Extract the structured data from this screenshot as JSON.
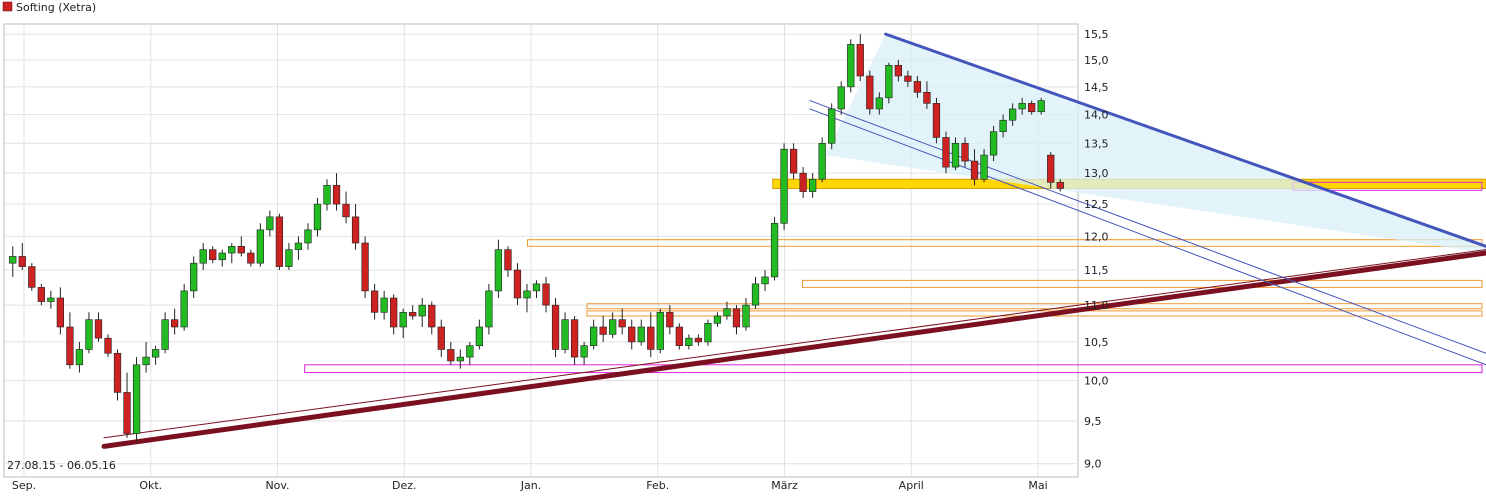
{
  "chart_data": {
    "type": "candlestick",
    "title": "Softing (Xetra)",
    "date_range_label": "27.08.15 - 06.05.16",
    "x_labels": [
      "Sep.",
      "Okt.",
      "Nov.",
      "Dez.",
      "Jan.",
      "Feb.",
      "März",
      "April",
      "Mai"
    ],
    "y_ticks": [
      "9,0",
      "9,5",
      "10,0",
      "10,5",
      "11,0",
      "11,5",
      "12,0",
      "12,5",
      "13,0",
      "13,5",
      "14,0",
      "14,5",
      "15,0",
      "15,5"
    ],
    "ylim": [
      8.85,
      15.7
    ],
    "scale": "log",
    "grid": true,
    "colors": {
      "up": "#22bb22",
      "down": "#cc2222",
      "support_main": "#7a1020",
      "channel": "#4455bb",
      "zone": "#ffd700",
      "band_orange": "#ee9933",
      "band_magenta": "#dd22dd",
      "fill_channel": "#d8f0f8"
    },
    "candles": [
      [
        11.6,
        11.85,
        11.4,
        11.7
      ],
      [
        11.7,
        11.9,
        11.5,
        11.55
      ],
      [
        11.55,
        11.6,
        11.2,
        11.25
      ],
      [
        11.25,
        11.3,
        11.0,
        11.05
      ],
      [
        11.05,
        11.2,
        10.95,
        11.1
      ],
      [
        11.1,
        11.25,
        10.6,
        10.7
      ],
      [
        10.7,
        10.9,
        10.15,
        10.2
      ],
      [
        10.2,
        10.5,
        10.1,
        10.4
      ],
      [
        10.4,
        10.9,
        10.35,
        10.8
      ],
      [
        10.8,
        10.9,
        10.5,
        10.55
      ],
      [
        10.55,
        10.6,
        10.3,
        10.35
      ],
      [
        10.35,
        10.4,
        9.75,
        9.85
      ],
      [
        9.85,
        10.1,
        9.3,
        9.35
      ],
      [
        9.35,
        10.3,
        9.25,
        10.2
      ],
      [
        10.2,
        10.5,
        10.1,
        10.3
      ],
      [
        10.3,
        10.45,
        10.2,
        10.4
      ],
      [
        10.4,
        10.9,
        10.35,
        10.8
      ],
      [
        10.8,
        10.95,
        10.6,
        10.7
      ],
      [
        10.7,
        11.3,
        10.65,
        11.2
      ],
      [
        11.2,
        11.7,
        11.1,
        11.6
      ],
      [
        11.6,
        11.9,
        11.5,
        11.8
      ],
      [
        11.8,
        11.85,
        11.6,
        11.65
      ],
      [
        11.65,
        11.8,
        11.55,
        11.75
      ],
      [
        11.75,
        11.9,
        11.6,
        11.85
      ],
      [
        11.85,
        12.0,
        11.7,
        11.75
      ],
      [
        11.75,
        11.8,
        11.55,
        11.6
      ],
      [
        11.6,
        12.2,
        11.55,
        12.1
      ],
      [
        12.1,
        12.4,
        12.0,
        12.3
      ],
      [
        12.3,
        12.35,
        11.5,
        11.55
      ],
      [
        11.55,
        11.9,
        11.5,
        11.8
      ],
      [
        11.8,
        12.0,
        11.65,
        11.9
      ],
      [
        11.9,
        12.2,
        11.8,
        12.1
      ],
      [
        12.1,
        12.6,
        12.0,
        12.5
      ],
      [
        12.5,
        12.9,
        12.4,
        12.8
      ],
      [
        12.8,
        13.0,
        12.4,
        12.5
      ],
      [
        12.5,
        12.7,
        12.2,
        12.3
      ],
      [
        12.3,
        12.5,
        11.8,
        11.9
      ],
      [
        11.9,
        12.0,
        11.1,
        11.2
      ],
      [
        11.2,
        11.3,
        10.8,
        10.9
      ],
      [
        10.9,
        11.2,
        10.8,
        11.1
      ],
      [
        11.1,
        11.15,
        10.6,
        10.7
      ],
      [
        10.7,
        10.95,
        10.55,
        10.9
      ],
      [
        10.9,
        11.0,
        10.8,
        10.85
      ],
      [
        10.85,
        11.1,
        10.7,
        11.0
      ],
      [
        11.0,
        11.05,
        10.6,
        10.7
      ],
      [
        10.7,
        10.8,
        10.3,
        10.4
      ],
      [
        10.4,
        10.5,
        10.2,
        10.25
      ],
      [
        10.25,
        10.4,
        10.15,
        10.3
      ],
      [
        10.3,
        10.5,
        10.2,
        10.45
      ],
      [
        10.45,
        10.8,
        10.4,
        10.7
      ],
      [
        10.7,
        11.3,
        10.6,
        11.2
      ],
      [
        11.2,
        11.95,
        11.1,
        11.8
      ],
      [
        11.8,
        11.85,
        11.4,
        11.5
      ],
      [
        11.5,
        11.6,
        11.0,
        11.1
      ],
      [
        11.1,
        11.3,
        10.9,
        11.2
      ],
      [
        11.2,
        11.35,
        11.1,
        11.3
      ],
      [
        11.3,
        11.4,
        10.9,
        11.0
      ],
      [
        11.0,
        11.1,
        10.3,
        10.4
      ],
      [
        10.4,
        10.9,
        10.35,
        10.8
      ],
      [
        10.8,
        10.85,
        10.2,
        10.3
      ],
      [
        10.3,
        10.5,
        10.2,
        10.45
      ],
      [
        10.45,
        10.8,
        10.4,
        10.7
      ],
      [
        10.7,
        10.85,
        10.5,
        10.6
      ],
      [
        10.6,
        10.9,
        10.55,
        10.8
      ],
      [
        10.8,
        10.95,
        10.6,
        10.7
      ],
      [
        10.7,
        10.8,
        10.4,
        10.5
      ],
      [
        10.5,
        10.8,
        10.45,
        10.7
      ],
      [
        10.7,
        10.9,
        10.3,
        10.4
      ],
      [
        10.4,
        10.95,
        10.35,
        10.9
      ],
      [
        10.9,
        11.0,
        10.6,
        10.7
      ],
      [
        10.7,
        10.75,
        10.4,
        10.45
      ],
      [
        10.45,
        10.6,
        10.4,
        10.55
      ],
      [
        10.55,
        10.6,
        10.45,
        10.5
      ],
      [
        10.5,
        10.8,
        10.45,
        10.75
      ],
      [
        10.75,
        10.9,
        10.7,
        10.85
      ],
      [
        10.85,
        11.05,
        10.8,
        10.95
      ],
      [
        10.95,
        11.0,
        10.6,
        10.7
      ],
      [
        10.7,
        11.1,
        10.65,
        11.0
      ],
      [
        11.0,
        11.4,
        10.95,
        11.3
      ],
      [
        11.3,
        11.5,
        11.2,
        11.4
      ],
      [
        11.4,
        12.3,
        11.35,
        12.2
      ],
      [
        12.2,
        13.5,
        12.1,
        13.4
      ],
      [
        13.4,
        13.5,
        12.9,
        13.0
      ],
      [
        13.0,
        13.1,
        12.6,
        12.7
      ],
      [
        12.7,
        13.0,
        12.6,
        12.9
      ],
      [
        12.9,
        13.6,
        12.85,
        13.5
      ],
      [
        13.5,
        14.2,
        13.4,
        14.1
      ],
      [
        14.1,
        14.6,
        14.0,
        14.5
      ],
      [
        14.5,
        15.4,
        14.4,
        15.3
      ],
      [
        15.3,
        15.5,
        14.6,
        14.7
      ],
      [
        14.7,
        14.8,
        14.0,
        14.1
      ],
      [
        14.1,
        14.4,
        14.0,
        14.3
      ],
      [
        14.3,
        14.95,
        14.2,
        14.9
      ],
      [
        14.9,
        15.0,
        14.6,
        14.7
      ],
      [
        14.7,
        14.8,
        14.5,
        14.6
      ],
      [
        14.6,
        14.7,
        14.3,
        14.4
      ],
      [
        14.4,
        14.6,
        14.1,
        14.2
      ],
      [
        14.2,
        14.3,
        13.5,
        13.6
      ],
      [
        13.6,
        13.7,
        13.0,
        13.1
      ],
      [
        13.1,
        13.6,
        13.05,
        13.5
      ],
      [
        13.5,
        13.6,
        13.1,
        13.2
      ],
      [
        13.2,
        13.4,
        12.8,
        12.9
      ],
      [
        12.9,
        13.4,
        12.85,
        13.3
      ],
      [
        13.3,
        13.8,
        13.2,
        13.7
      ],
      [
        13.7,
        14.0,
        13.6,
        13.9
      ],
      [
        13.9,
        14.2,
        13.8,
        14.1
      ],
      [
        14.1,
        14.3,
        14.0,
        14.2
      ],
      [
        14.2,
        14.25,
        14.0,
        14.05
      ],
      [
        14.05,
        14.3,
        14.0,
        14.25
      ],
      [
        13.3,
        13.35,
        12.75,
        12.85
      ],
      [
        12.85,
        12.9,
        12.7,
        12.75
      ]
    ],
    "lines": [
      {
        "kind": "main_support",
        "points": [
          [
            0.07,
            9.2
          ],
          [
            1.0,
            11.75
          ]
        ]
      },
      {
        "kind": "support_thin",
        "points": [
          [
            0.07,
            9.3
          ],
          [
            1.0,
            11.8
          ]
        ]
      },
      {
        "kind": "channel_upper",
        "points": [
          [
            0.596,
            15.5
          ],
          [
            1.0,
            11.85
          ]
        ]
      },
      {
        "kind": "channel_lower",
        "points": [
          [
            0.545,
            14.1
          ],
          [
            1.0,
            10.2
          ]
        ]
      },
      {
        "kind": "channel_lower2",
        "points": [
          [
            0.545,
            14.25
          ],
          [
            1.0,
            10.35
          ]
        ]
      }
    ],
    "bands": [
      {
        "kind": "zone",
        "y0": 12.75,
        "y1": 12.9,
        "x0": 0.52
      },
      {
        "kind": "orange",
        "y0": 11.85,
        "y1": 11.95,
        "x0": 0.355
      },
      {
        "kind": "orange",
        "y0": 11.25,
        "y1": 11.35,
        "x0": 0.54
      },
      {
        "kind": "orange",
        "y0": 10.95,
        "y1": 11.02,
        "x0": 0.395
      },
      {
        "kind": "orange",
        "y0": 10.85,
        "y1": 10.92,
        "x0": 0.395
      },
      {
        "kind": "magenta",
        "y0": 10.1,
        "y1": 10.2,
        "x0": 0.205
      },
      {
        "kind": "magenta",
        "y0": 12.72,
        "y1": 12.85,
        "x0": 0.87
      }
    ]
  }
}
